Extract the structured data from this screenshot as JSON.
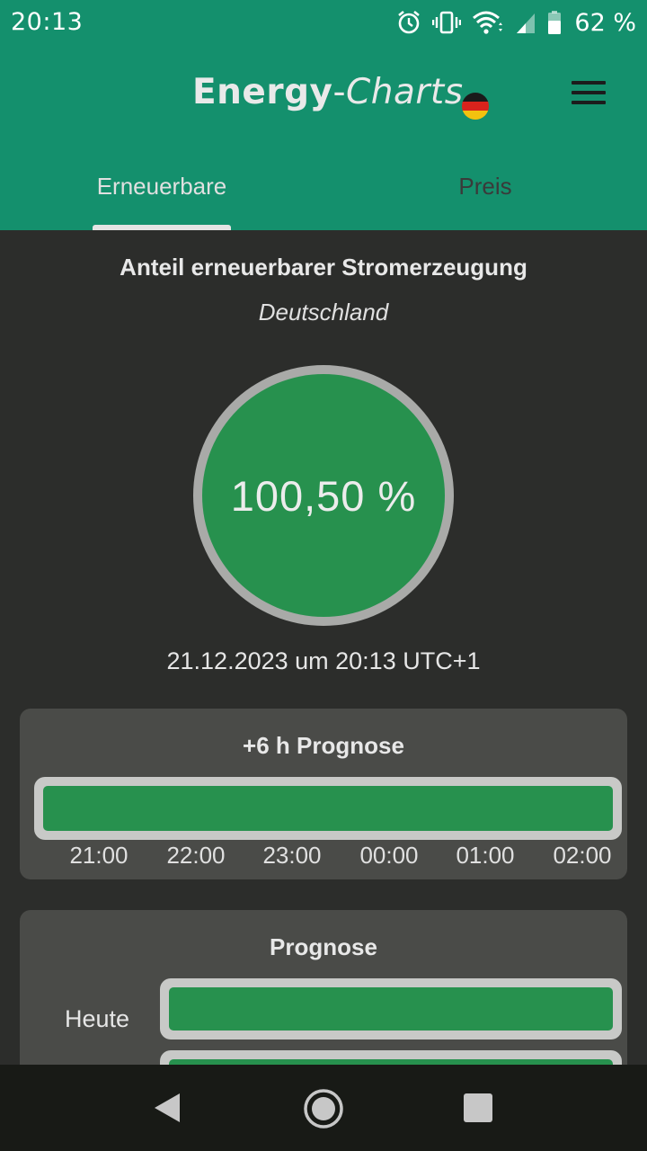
{
  "status_bar": {
    "time": "20:13",
    "battery": "62 %",
    "icons": [
      "alarm-icon",
      "vibrate-icon",
      "wifi-icon",
      "signal-icon",
      "battery-icon"
    ]
  },
  "app_bar": {
    "logo_bold": "Energy",
    "logo_dash": "-",
    "logo_italic": "Charts",
    "flag": "germany-flag-icon",
    "menu": "hamburger-menu-icon"
  },
  "tabs": [
    {
      "label": "Erneuerbare",
      "active": true
    },
    {
      "label": "Preis",
      "active": false
    }
  ],
  "main": {
    "title": "Anteil erneuerbarer Stromerzeugung",
    "region": "Deutschland",
    "share_value": "100,50 %",
    "timestamp": "21.12.2023 um 20:13 UTC+1"
  },
  "forecast_6h": {
    "title": "+6 h Prognose",
    "times": [
      "21:00",
      "22:00",
      "23:00",
      "00:00",
      "01:00",
      "02:00"
    ],
    "fill_fraction": 1.0
  },
  "forecast": {
    "title": "Prognose",
    "rows": [
      {
        "label": "Heute",
        "fill_fraction": 1.0
      }
    ]
  },
  "colors": {
    "header": "#14906d",
    "background": "#2c2d2b",
    "card": "#4a4b48",
    "green": "#27914e",
    "gauge_ring": "#a9aaa8"
  },
  "nav_bar": {
    "back": "back-triangle-icon",
    "home": "home-circle-icon",
    "recent": "recents-square-icon"
  }
}
